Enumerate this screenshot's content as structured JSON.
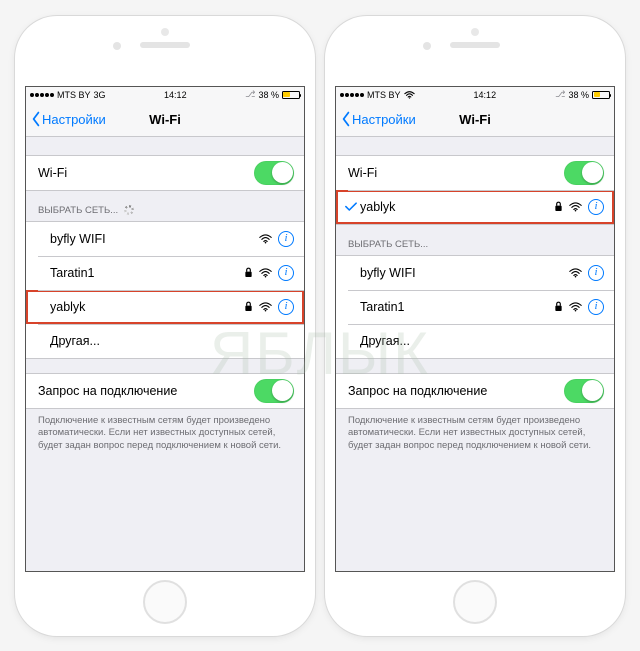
{
  "status": {
    "carrier": "MTS BY",
    "network": "3G",
    "time": "14:12",
    "battery_percent": "38 %",
    "signal_filled": 5
  },
  "navbar": {
    "back": "Настройки",
    "title": "Wi-Fi"
  },
  "wifi_row": {
    "label": "Wi-Fi"
  },
  "choose_header": "ВЫБРАТЬ СЕТЬ...",
  "left_networks": [
    {
      "name": "byfly WIFI",
      "lock": false
    },
    {
      "name": "Taratin1",
      "lock": true
    },
    {
      "name": "yablyk",
      "lock": true
    }
  ],
  "right_connected": {
    "name": "yablyk",
    "lock": true
  },
  "right_networks": [
    {
      "name": "byfly WIFI",
      "lock": false
    },
    {
      "name": "Taratin1",
      "lock": true
    }
  ],
  "other": "Другая...",
  "ask": {
    "label": "Запрос на подключение",
    "footer": "Подключение к известным сетям будет произведено автоматически. Если нет известных доступных сетей, будет задан вопрос перед подключением к новой сети."
  },
  "watermark": "ЯБЛЫК"
}
